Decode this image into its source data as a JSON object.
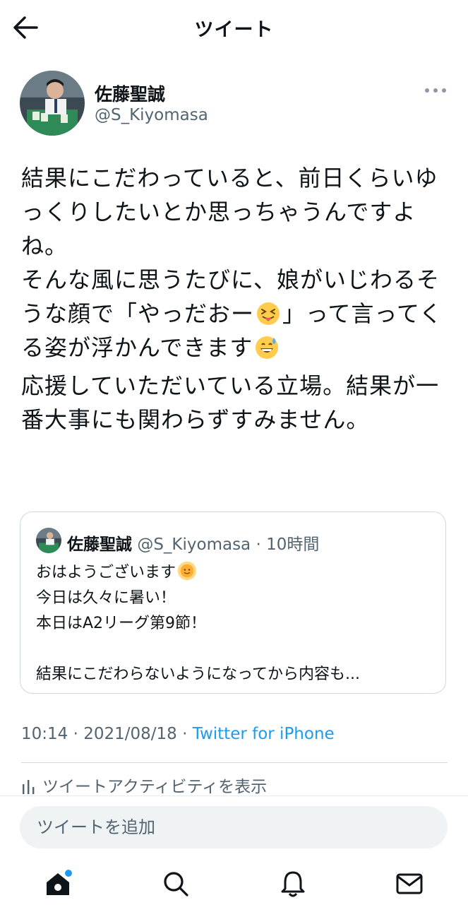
{
  "header": {
    "title": "ツイート",
    "back_icon": "arrow-left-icon"
  },
  "author": {
    "name": "佐藤聖誠",
    "handle": "@S_Kiyomasa"
  },
  "tweet": {
    "text_part1": "結果にこだわっていると、前日くらいゆっくりしたいとか思っちゃうんですよね。\nそんな風に思うたびに、娘がいじわるそうな顔で「やっだおー",
    "emoji1": "squinting-tongue-face",
    "text_part2": "」って言ってくる姿が浮かんできます",
    "emoji2": "grinning-sweat-face",
    "text_part3": "応援していただいている立場。結果が一番大事にも関わらずすみません。"
  },
  "quote": {
    "name": "佐藤聖誠",
    "handle_time": "@S_Kiyomasa · 10時間",
    "line1": "おはようございます",
    "emoji": "sun-face",
    "line2": "今日は久々に暑い！",
    "line3": "本日はA2リーグ第9節！",
    "line4": "結果にこだわらないようになってから内容も..."
  },
  "meta": {
    "time_date": "10:14 · 2021/08/18 · ",
    "source": "Twitter for iPhone"
  },
  "activity": {
    "label": "ツイートアクティビティを表示",
    "icon": "bar-chart-icon"
  },
  "reply": {
    "placeholder": "ツイートを追加"
  },
  "nav": {
    "items": [
      "home-icon",
      "search-icon",
      "notifications-icon",
      "messages-icon"
    ]
  },
  "colors": {
    "accent": "#1d9bf0",
    "text": "#0f1419",
    "secondary": "#536471",
    "border": "#cfd9de",
    "input_bg": "#eff3f4"
  }
}
